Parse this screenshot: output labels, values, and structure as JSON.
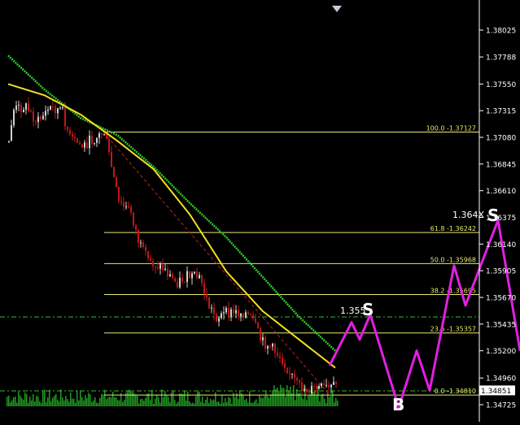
{
  "chart_data": {
    "type": "line",
    "title": "",
    "xlabel": "",
    "ylabel": "",
    "ylim": [
      1.34725,
      1.38025
    ],
    "y_ticks": [
      1.38025,
      1.37788,
      1.3755,
      1.37315,
      1.3708,
      1.36845,
      1.3661,
      1.36375,
      1.3614,
      1.35905,
      1.3567,
      1.35435,
      1.352,
      1.3496,
      1.34725
    ],
    "y_tick_labels": [
      "1.38025",
      "1.37788",
      "1.37550",
      "1.37315",
      "1.37080",
      "1.36845",
      "1.36610",
      "1.36375",
      "1.36140",
      "1.35905",
      "1.35670",
      "1.35435",
      "1.35200",
      "1.34960",
      "1.34725"
    ],
    "current_price": 1.34851,
    "current_price_label": "1.34851",
    "fibonacci": [
      {
        "label": "100.0 -1.37127",
        "value": 1.37127
      },
      {
        "label": "61.8 -1.36242",
        "value": 1.36242
      },
      {
        "label": "50.0 -1.35968",
        "value": 1.35968
      },
      {
        "label": "38.2 -1.35695",
        "value": 1.35695
      },
      {
        "label": "23.6 -1.35357",
        "value": 1.35357
      },
      {
        "label": "0.0 -1.34810",
        "value": 1.3481
      }
    ],
    "forecast_path": [
      1.3507,
      1.3545,
      1.353,
      1.3552,
      1.3505,
      1.347,
      1.352,
      1.3485,
      1.3595,
      1.356,
      1.3635,
      1.352
    ],
    "annotations": [
      {
        "text": "1.355",
        "value": 1.3555
      },
      {
        "text": "1.364X",
        "value": 1.364
      }
    ],
    "signal_labels": [
      {
        "text": "S",
        "value": 1.3558
      },
      {
        "text": "S",
        "value": 1.3642
      },
      {
        "text": "B",
        "value": 1.3473
      }
    ],
    "series": [
      {
        "values": [
          1.3755,
          1.3745,
          1.3728,
          1.3705,
          1.368,
          1.364,
          1.359,
          1.3555,
          1.353,
          1.3505
        ]
      },
      {
        "values": [
          1.378,
          1.375,
          1.3725,
          1.371,
          1.3682,
          1.365,
          1.362,
          1.3585,
          1.355,
          1.352
        ]
      }
    ],
    "colors": {
      "background": "#000000",
      "fib": "#e8e870",
      "slow_ma": "#2ecc2e",
      "fast_ma": "#f0e020",
      "forecast": "#e020e0",
      "candle_down": "#c01818",
      "candle_up": "#d0d0d0",
      "volume": "#1f9a1f",
      "axis_text": "#ffffff",
      "guide": "#2fbf2f"
    }
  }
}
